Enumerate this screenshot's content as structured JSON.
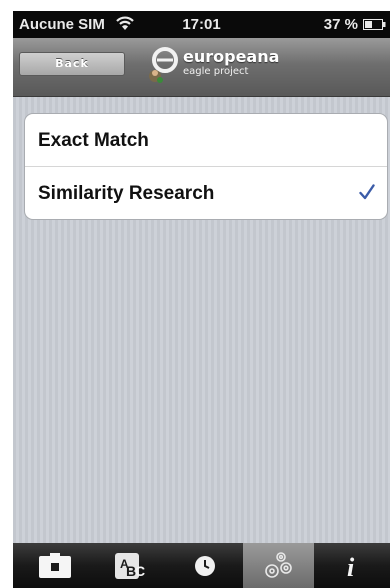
{
  "status_bar": {
    "carrier": "Aucune SIM",
    "time": "17:01",
    "battery": "37 %",
    "icons": [
      "wifi-icon",
      "battery-icon"
    ]
  },
  "nav_bar": {
    "back_label": "Back",
    "logo_title": "europeana",
    "logo_subtitle": "eagle project"
  },
  "options": [
    {
      "label": "Exact Match",
      "selected": false
    },
    {
      "label": "Similarity Research",
      "selected": true
    }
  ],
  "colors": {
    "checkmark": "#3b5ca8",
    "tab_selected": "#8a8a8a"
  },
  "tab_bar": {
    "tabs": [
      {
        "icon": "camera-icon",
        "selected": false
      },
      {
        "icon": "text-recognition-icon",
        "selected": false
      },
      {
        "icon": "clock-icon",
        "selected": false
      },
      {
        "icon": "gears-icon",
        "selected": true
      },
      {
        "icon": "info-icon",
        "selected": false
      }
    ]
  }
}
